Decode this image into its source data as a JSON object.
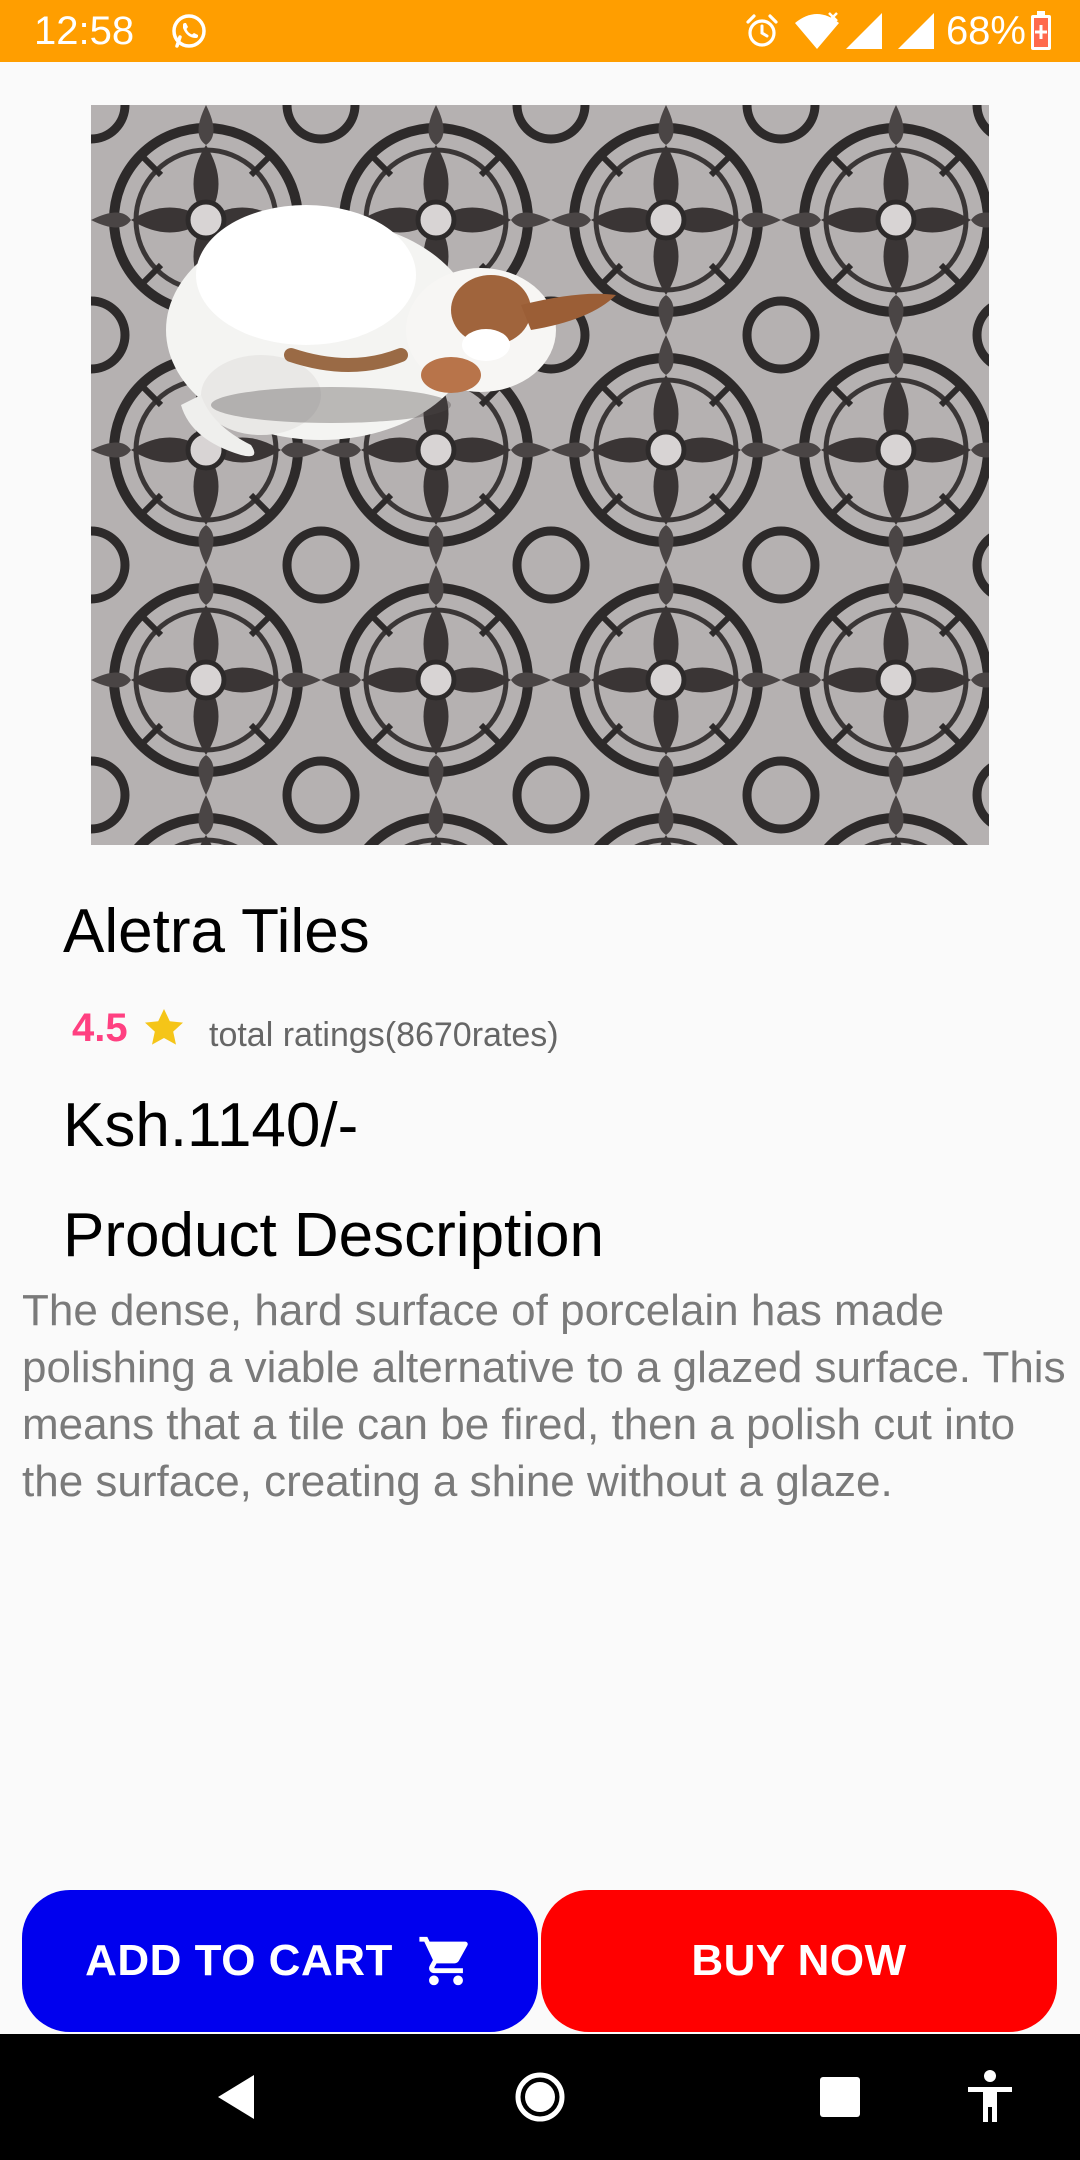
{
  "status_bar": {
    "time": "12:58",
    "battery": "68%",
    "icons": [
      "whatsapp-icon",
      "alarm-icon",
      "wifi-icon",
      "signal-icon",
      "battery-icon"
    ],
    "background": "#ff9e00"
  },
  "product": {
    "image_alt": "dog-on-patterned-tile",
    "title": "Aletra Tiles",
    "rating": "4.5",
    "rating_total": "total ratings(8670rates)",
    "price": "Ksh.1140/-",
    "description_heading": "Product Description",
    "description": "The dense, hard surface of porcelain has made polishing a viable alternative to a glazed surface. This means that a tile can be fired, then a polish cut into the surface, creating a shine without a glaze."
  },
  "buttons": {
    "add_to_cart": "ADD TO CART",
    "buy_now": "BUY NOW"
  },
  "colors": {
    "accent_rating": "#ff4081",
    "add_to_cart": "#0000ee",
    "buy_now": "#ff0000",
    "star": "#f5c518"
  },
  "nav_bar": {
    "icons": [
      "back-icon",
      "home-icon",
      "recents-icon",
      "accessibility-icon"
    ]
  }
}
